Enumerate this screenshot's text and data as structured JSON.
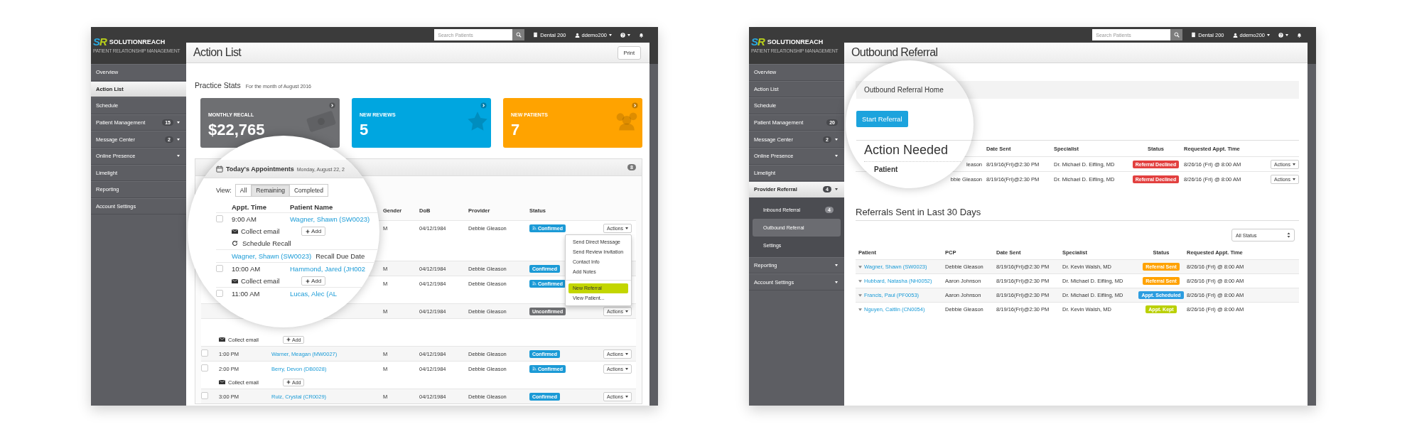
{
  "windows": [
    {
      "kind": "action_list",
      "logo": {
        "mark": "SR",
        "name": "SOLUTIONREACH",
        "tagline": "PATIENT RELATIONSHIP MANAGEMENT"
      },
      "topbar": {
        "search_placeholder": "Search Patients",
        "practice": "Dental 200",
        "user": "ddemo200"
      },
      "sidebar": [
        {
          "label": "Overview",
          "selected": false,
          "expandable": false
        },
        {
          "label": "Action List",
          "selected": true,
          "expandable": false
        },
        {
          "label": "Schedule",
          "selected": false,
          "expandable": false
        },
        {
          "label": "Patient Management",
          "badge": "15",
          "selected": false,
          "expandable": true
        },
        {
          "label": "Message Center",
          "badge": "2",
          "selected": false,
          "expandable": true
        },
        {
          "label": "Online Presence",
          "selected": false,
          "expandable": true
        },
        {
          "label": "Limelight",
          "selected": false,
          "expandable": false
        },
        {
          "label": "Reporting",
          "selected": false,
          "expandable": false
        },
        {
          "label": "Account Settings",
          "selected": false,
          "expandable": false
        }
      ],
      "title": "Action List",
      "print_button": "Print",
      "stats_title": "Practice Stats",
      "stats_subtitle": "For the month of August 2016",
      "stats": [
        {
          "kind": "money",
          "label": "MONTHLY RECALL",
          "value": "$22,765",
          "color": "#6e6f72"
        },
        {
          "kind": "star",
          "label": "NEW REVIEWS",
          "value": "5",
          "color": "#00a6e0"
        },
        {
          "kind": "people",
          "label": "NEW PATIENTS",
          "value": "7",
          "color": "#ffa300"
        }
      ],
      "appointments": {
        "title": "Today's Appointments",
        "date": "Monday, August 22, 2",
        "count": "8",
        "view_label": "View:",
        "views": [
          {
            "label": "All",
            "selected": false
          },
          {
            "label": "Remaining",
            "selected": true
          },
          {
            "label": "Completed",
            "selected": false
          }
        ],
        "columns": [
          "Appt. Time",
          "Patient Name",
          "Gender",
          "DoB",
          "Provider",
          "Status"
        ],
        "rows": [
          {
            "kind": "appointment",
            "magnified": true,
            "checked": false,
            "time": "9:00 AM",
            "patient": "Wagner, Shawn (SW0023)",
            "gender": "M",
            "dob": "04/12/1984",
            "provider": "Debbie Gleason",
            "status": {
              "label": "Confirmed",
              "color": "#1b9ad6",
              "texted": true
            },
            "actions": "Actions",
            "menu_open": true,
            "menu": {
              "groups": [
                {
                  "items": [
                    {
                      "label": "Send Direct Message",
                      "highlighted": false
                    },
                    {
                      "label": "Send Review Invitation",
                      "highlighted": false
                    },
                    {
                      "label": "Contact Info",
                      "highlighted": false
                    },
                    {
                      "label": "Add Notes",
                      "highlighted": false
                    }
                  ]
                },
                {
                  "items": [
                    {
                      "label": "New Referral",
                      "highlighted": true
                    },
                    {
                      "label": "View Patient...",
                      "highlighted": false
                    }
                  ]
                }
              ]
            },
            "tasks": [
              {
                "kind": "email",
                "label": "Collect email",
                "button": "Add"
              },
              {
                "kind": "recall",
                "label": "Schedule Recall"
              }
            ]
          },
          {
            "kind": "recall",
            "magnified": true,
            "patient": "Wagner, Shawn (SW0023)",
            "note": "Recall Due Date",
            "gender": "M",
            "dob": "04/12/1984",
            "provider": "Debbie Gleason",
            "status": {
              "label": "Confirmed",
              "color": "#1b9ad6",
              "texted": false
            }
          },
          {
            "kind": "appointment",
            "magnified": true,
            "checked": false,
            "time": "10:00 AM",
            "patient": "Hammond, Jared (JH002",
            "gender": "M",
            "dob": "04/12/1984",
            "provider": "Debbie Gleason",
            "status": {
              "label": "Confirmed",
              "color": "#1b9ad6",
              "texted": true
            },
            "tasks": [
              {
                "kind": "email",
                "label": "Collect email",
                "button": "Add"
              }
            ]
          },
          {
            "kind": "appointment",
            "magnified": true,
            "checked": false,
            "time": "11:00 AM",
            "patient": "Lucas, Alec (AL",
            "gender": "M",
            "dob": "04/12/1984",
            "provider": "Debbie Gleason",
            "status": {
              "label": "Unconfirmed",
              "color": "#6d6e71",
              "texted": false
            },
            "actions": "Actions"
          },
          {
            "kind": "appointment",
            "magnified": false,
            "tasks": [
              {
                "kind": "email",
                "label": "Collect email",
                "button": "Add"
              }
            ]
          },
          {
            "kind": "appointment",
            "magnified": false,
            "checked": false,
            "time": "1:00 PM",
            "patient": "Warner, Meagan (MW0027)",
            "gender": "M",
            "dob": "04/12/1984",
            "provider": "Debbie Gleason",
            "status": {
              "label": "Confirmed",
              "color": "#1b9ad6",
              "texted": false
            },
            "actions": "Actions"
          },
          {
            "kind": "appointment",
            "magnified": false,
            "checked": false,
            "time": "2:00 PM",
            "patient": "Berry, Devon (DB0028)",
            "gender": "M",
            "dob": "04/12/1984",
            "provider": "Debbie Gleason",
            "status": {
              "label": "Confirmed",
              "color": "#1b9ad6",
              "texted": true
            },
            "actions": "Actions",
            "tasks": [
              {
                "kind": "email",
                "label": "Collect email",
                "button": "Add"
              }
            ]
          },
          {
            "kind": "appointment",
            "magnified": false,
            "checked": false,
            "time": "3:00 PM",
            "patient": "Ruiz, Crystal (CR0029)",
            "gender": "M",
            "dob": "04/12/1984",
            "provider": "Debbie Gleason",
            "status": {
              "label": "Confirmed",
              "color": "#1b9ad6",
              "texted": false
            },
            "actions": "Actions"
          }
        ]
      }
    },
    {
      "kind": "outbound_referral",
      "logo": {
        "mark": "SR",
        "name": "SOLUTIONREACH",
        "tagline": "PATIENT RELATIONSHIP MANAGEMENT"
      },
      "topbar": {
        "search_placeholder": "Search Patients",
        "practice": "Dental 200",
        "user": "ddemo200"
      },
      "sidebar": [
        {
          "label": "Overview",
          "selected": false,
          "expandable": false
        },
        {
          "label": "Action List",
          "selected": false,
          "expandable": false
        },
        {
          "label": "Schedule",
          "selected": false,
          "expandable": false
        },
        {
          "label": "Patient Management",
          "badge": "20",
          "selected": false,
          "expandable": false
        },
        {
          "label": "Message Center",
          "badge": "2",
          "selected": false,
          "expandable": true
        },
        {
          "label": "Online Presence",
          "selected": false,
          "expandable": true
        },
        {
          "label": "Limelight",
          "selected": false,
          "expandable": false
        },
        {
          "label": "Provider Referral",
          "badge": "4",
          "selected": true,
          "expandable": true,
          "children": [
            {
              "label": "Inbound Referral",
              "badge": "4",
              "selected": false
            },
            {
              "label": "Outbound Referral",
              "selected": true
            },
            {
              "label": "Settings",
              "selected": false
            }
          ]
        },
        {
          "label": "Reporting",
          "selected": false,
          "expandable": true
        },
        {
          "label": "Account Settings",
          "selected": false,
          "expandable": true
        }
      ],
      "title": "Outbound Referral",
      "breadcrumb": "Outbound Referral Home",
      "start_button": "Start Referral",
      "action_needed": {
        "title": "Action Needed",
        "columns": [
          "Patient",
          "Date Sent",
          "Specialist",
          "Status",
          "Requested Appt. Time"
        ],
        "rows": [
          {
            "pcp": "leason",
            "date": "8/19/16(Fri)@2:30 PM",
            "specialist": "Dr. Michael D. Eifling, MD",
            "status": {
              "label": "Referral Declined",
              "color": "#e2403f"
            },
            "requested": "8/26/16 (Fri) @ 8:00 AM",
            "actions": "Actions"
          },
          {
            "pcp": "bbie Gleason",
            "date": "8/19/16(Fri)@2:30 PM",
            "specialist": "Dr. Michael D. Eifling, MD",
            "status": {
              "label": "Referral Declined",
              "color": "#e2403f"
            },
            "requested": "8/26/16 (Fri) @ 8:00 AM",
            "actions": "Actions"
          }
        ]
      },
      "referrals": {
        "title": "Referrals Sent in Last 30 Days",
        "filter": "All Status",
        "columns": [
          "Patient",
          "PCP",
          "Date Sent",
          "Specialist",
          "Status",
          "Requested Appt. Time"
        ],
        "rows": [
          {
            "patient": "Wagner, Shawn (SW0023)",
            "pcp": "Debbie Gleason",
            "date": "8/19/16(Fri)@2:30 PM",
            "specialist": "Dr. Kevin Walsh, MD",
            "status": {
              "label": "Referral Sent",
              "color": "#ffa200"
            },
            "requested": "8/26/16 (Fri) @ 8:00 AM"
          },
          {
            "patient": "Hubbard, Natasha (NH0052)",
            "pcp": "Aaron Johnson",
            "date": "8/19/16(Fri)@2:30 PM",
            "specialist": "Dr. Michael D. Eifling, MD",
            "status": {
              "label": "Referral Sent",
              "color": "#ffa200"
            },
            "requested": "8/26/16 (Fri) @ 8:00 AM"
          },
          {
            "patient": "Francis, Paul (PF0053)",
            "pcp": "Aaron Johnson",
            "date": "8/19/16(Fri)@2:30 PM",
            "specialist": "Dr. Michael D. Eifling, MD",
            "status": {
              "label": "Appt. Scheduled",
              "color": "#2d9de0"
            },
            "requested": "8/26/16 (Fri) @ 8:00 AM"
          },
          {
            "patient": "Nguyen, Caitlin (CN0054)",
            "pcp": "Debbie Gleason",
            "date": "8/19/16(Fri)@2:30 PM",
            "specialist": "Dr. Kevin Walsh, MD",
            "status": {
              "label": "Appt. Kept",
              "color": "#bad000"
            },
            "requested": "8/26/16 (Fri) @ 8:00 AM"
          }
        ]
      }
    }
  ]
}
